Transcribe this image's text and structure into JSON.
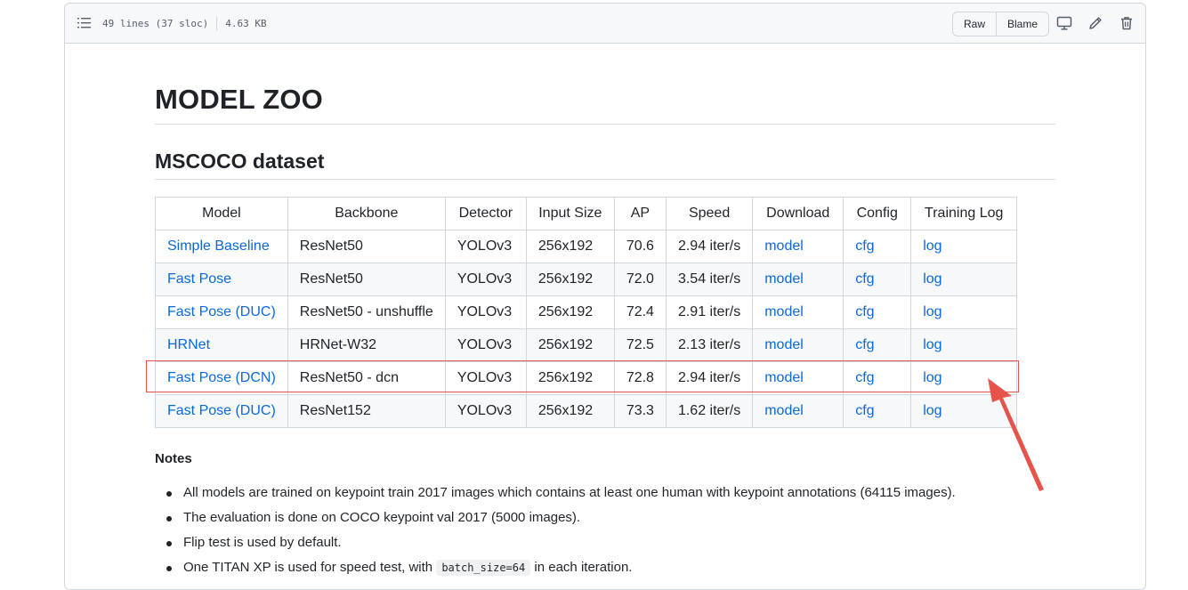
{
  "file_header": {
    "lines_info": "49 lines (37 sloc)",
    "size_info": "4.63 KB",
    "raw_label": "Raw",
    "blame_label": "Blame",
    "icons": [
      "list-icon",
      "desktop-icon",
      "pencil-icon",
      "trash-icon"
    ]
  },
  "doc": {
    "title": "MODEL ZOO",
    "section_title": "MSCOCO dataset",
    "table": {
      "headers": [
        "Model",
        "Backbone",
        "Detector",
        "Input Size",
        "AP",
        "Speed",
        "Download",
        "Config",
        "Training Log"
      ],
      "rows": [
        {
          "model": "Simple Baseline",
          "backbone": "ResNet50",
          "detector": "YOLOv3",
          "input_size": "256x192",
          "ap": "70.6",
          "speed": "2.94 iter/s",
          "download": "model",
          "config": "cfg",
          "log": "log"
        },
        {
          "model": "Fast Pose",
          "backbone": "ResNet50",
          "detector": "YOLOv3",
          "input_size": "256x192",
          "ap": "72.0",
          "speed": "3.54 iter/s",
          "download": "model",
          "config": "cfg",
          "log": "log"
        },
        {
          "model": "Fast Pose (DUC)",
          "backbone": "ResNet50 - unshuffle",
          "detector": "YOLOv3",
          "input_size": "256x192",
          "ap": "72.4",
          "speed": "2.91 iter/s",
          "download": "model",
          "config": "cfg",
          "log": "log"
        },
        {
          "model": "HRNet",
          "backbone": "HRNet-W32",
          "detector": "YOLOv3",
          "input_size": "256x192",
          "ap": "72.5",
          "speed": "2.13 iter/s",
          "download": "model",
          "config": "cfg",
          "log": "log"
        },
        {
          "model": "Fast Pose (DCN)",
          "backbone": "ResNet50 - dcn",
          "detector": "YOLOv3",
          "input_size": "256x192",
          "ap": "72.8",
          "speed": "2.94 iter/s",
          "download": "model",
          "config": "cfg",
          "log": "log"
        },
        {
          "model": "Fast Pose (DUC)",
          "backbone": "ResNet152",
          "detector": "YOLOv3",
          "input_size": "256x192",
          "ap": "73.3",
          "speed": "1.62 iter/s",
          "download": "model",
          "config": "cfg",
          "log": "log"
        }
      ]
    },
    "notes_title": "Notes",
    "notes": [
      "All models are trained on keypoint train 2017 images which contains at least one human with keypoint annotations (64115 images).",
      "The evaluation is done on COCO keypoint val 2017 (5000 images).",
      "Flip test is used by default.",
      "One TITAN XP is used for speed test, with"
    ],
    "note_code": "batch_size=64",
    "note_suffix": "in each iteration."
  },
  "colors": {
    "link": "#0969da",
    "annotation_red": "#e5534b",
    "border": "#d0d7de"
  }
}
